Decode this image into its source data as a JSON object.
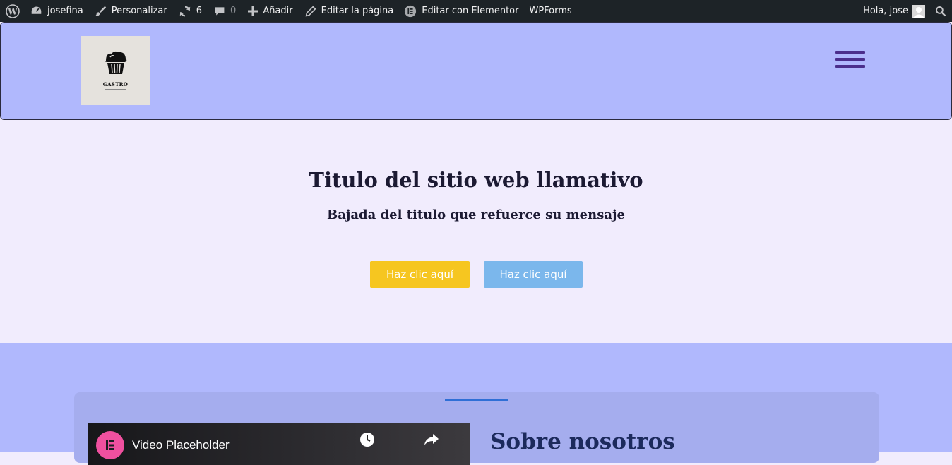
{
  "adminbar": {
    "site_name": "josefina",
    "customize": "Personalizar",
    "updates_count": "6",
    "comments_count": "0",
    "add_new": "Añadir",
    "edit_page": "Editar la página",
    "edit_elementor": "Editar con Elementor",
    "wpforms": "WPForms",
    "greeting": "Hola, jose",
    "icons": [
      "wordpress-icon",
      "dashboard-icon",
      "brush-icon",
      "updates-icon",
      "comment-icon",
      "plus-icon",
      "pencil-icon",
      "elementor-icon",
      "avatar",
      "search-icon"
    ]
  },
  "header": {
    "logo_text": "GASTRO",
    "logo_icon": "muffin-icon",
    "menu_icon": "hamburger-icon"
  },
  "hero": {
    "title": "Titulo del sitio web llamativo",
    "subtitle": "Bajada del titulo que refuerce su mensaje",
    "buttons": [
      {
        "label": "Haz clic aquí",
        "color": "#f6c620"
      },
      {
        "label": "Haz clic aquí",
        "color": "#7bb7ec"
      }
    ]
  },
  "about": {
    "video_title": "Video Placeholder",
    "heading": "Sobre nosotros"
  },
  "colors": {
    "adminbar_bg": "#1d2327",
    "header_bg": "#b0b8fd",
    "hero_bg": "#f1ecfd",
    "hamburger": "#4b2e8c",
    "heading_text": "#1c1a33",
    "elementor_pink": "#f0509f"
  }
}
